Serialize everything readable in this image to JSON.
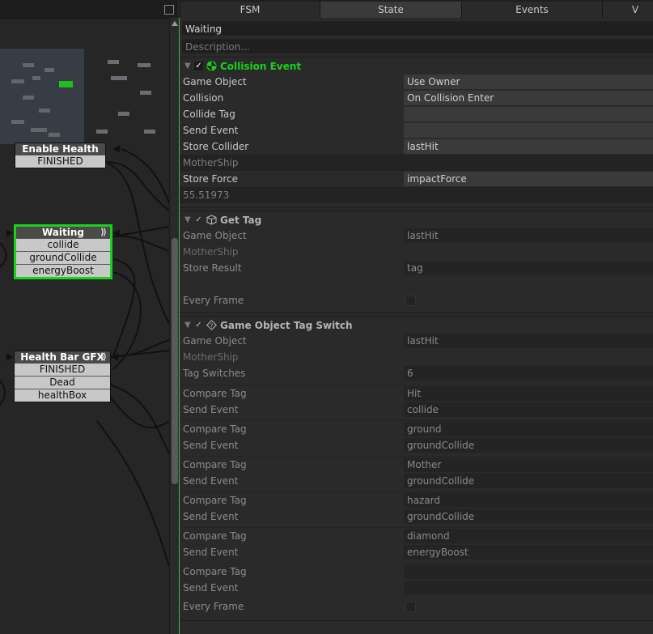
{
  "colors": {
    "accent_green": "#18d418",
    "active_border": "#18d418"
  },
  "tabs": [
    "FSM",
    "State",
    "Events",
    "V"
  ],
  "state": {
    "name": "Waiting",
    "description_placeholder": "Description..."
  },
  "graph": {
    "nodes": [
      {
        "title": "Enable Health",
        "events": [
          "FINISHED"
        ]
      },
      {
        "title": "Waiting",
        "events": [
          "collide",
          "groundCollide",
          "energyBoost"
        ]
      },
      {
        "title": "Health Bar GFX",
        "events": [
          "FINISHED",
          "Dead",
          "healthBox"
        ]
      }
    ]
  },
  "actions": {
    "collision_event": {
      "title": "Collision Event",
      "icon": "collision-icon",
      "rows": [
        {
          "label": "Game Object",
          "value": "Use Owner"
        },
        {
          "label": "Collision",
          "value": "On Collision Enter"
        },
        {
          "label": "Collide Tag",
          "value": ""
        },
        {
          "label": "Send Event",
          "value": ""
        },
        {
          "label": "Store Collider",
          "value": "lastHit"
        }
      ],
      "store_collider_value": "MotherShip",
      "store_force_label": "Store Force",
      "store_force_value": "impactForce",
      "store_force_readout": "55.51973"
    },
    "get_tag": {
      "title": "Get Tag",
      "icon": "cube-icon",
      "game_object_label": "Game Object",
      "game_object_value": "lastHit",
      "game_object_readout": "MotherShip",
      "store_result_label": "Store Result",
      "store_result_value": "tag",
      "every_frame_label": "Every Frame"
    },
    "tag_switch": {
      "title": "Game Object Tag Switch",
      "icon": "tag-switch-icon",
      "game_object_label": "Game Object",
      "game_object_value": "lastHit",
      "game_object_readout": "MotherShip",
      "tag_switches_label": "Tag Switches",
      "tag_switches_value": "6",
      "compare_tag_label": "Compare Tag",
      "send_event_label": "Send Event",
      "pairs": [
        {
          "compare": "Hit",
          "event": "collide"
        },
        {
          "compare": "ground",
          "event": "groundCollide"
        },
        {
          "compare": "Mother",
          "event": "groundCollide"
        },
        {
          "compare": "hazard",
          "event": "groundCollide"
        },
        {
          "compare": "diamond",
          "event": "energyBoost"
        },
        {
          "compare": "",
          "event": ""
        }
      ],
      "every_frame_label": "Every Frame"
    }
  }
}
